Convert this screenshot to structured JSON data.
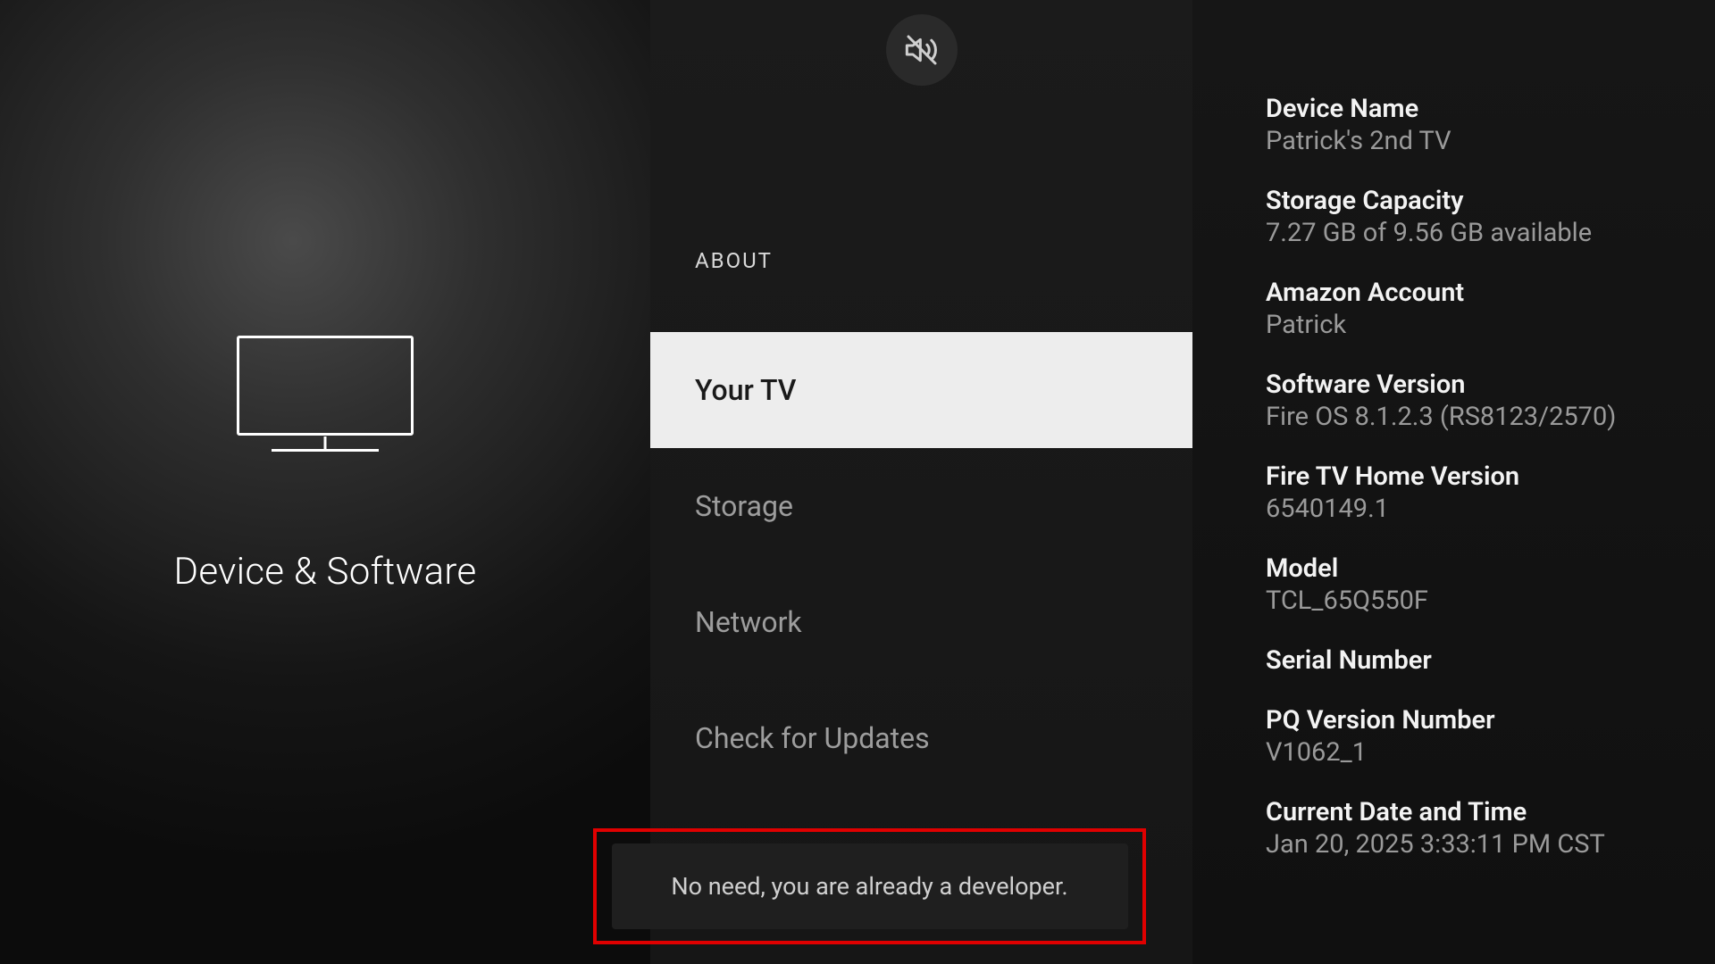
{
  "left": {
    "title": "Device & Software",
    "icon_name": "tv-icon"
  },
  "header": {
    "mute_icon": "speaker-muted-icon"
  },
  "middle": {
    "section_header": "ABOUT",
    "menu": [
      {
        "label": "Your TV",
        "selected": true
      },
      {
        "label": "Storage",
        "selected": false
      },
      {
        "label": "Network",
        "selected": false
      },
      {
        "label": "Check for Updates",
        "selected": false
      }
    ]
  },
  "right": {
    "info": [
      {
        "label": "Device Name",
        "value": "Patrick's 2nd TV"
      },
      {
        "label": "Storage Capacity",
        "value": "7.27 GB of 9.56 GB available"
      },
      {
        "label": "Amazon Account",
        "value": "Patrick"
      },
      {
        "label": "Software Version",
        "value": "Fire OS 8.1.2.3 (RS8123/2570)"
      },
      {
        "label": "Fire TV Home Version",
        "value": "6540149.1"
      },
      {
        "label": "Model",
        "value": "TCL_65Q550F"
      },
      {
        "label": "Serial Number",
        "value": ""
      },
      {
        "label": "PQ Version Number",
        "value": "V1062_1"
      },
      {
        "label": "Current Date and Time",
        "value": "Jan 20, 2025 3:33:11 PM CST"
      }
    ]
  },
  "toast": {
    "message": "No need, you are already a developer."
  }
}
